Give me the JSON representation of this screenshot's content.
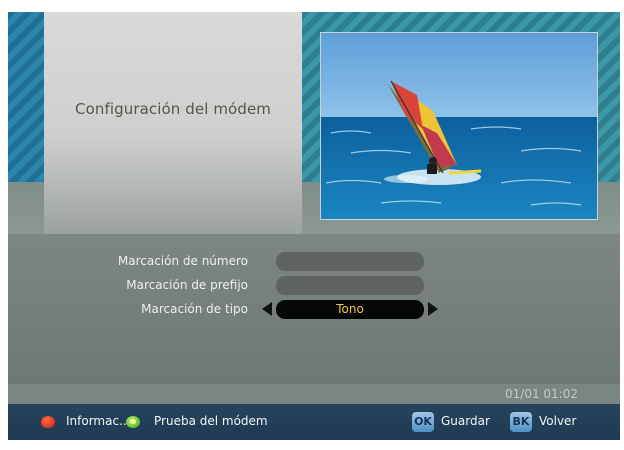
{
  "screen": {
    "title": "Configuración del módem"
  },
  "settings": {
    "rows": [
      {
        "label": "Marcación de número",
        "value": ""
      },
      {
        "label": "Marcación de prefijo",
        "value": ""
      },
      {
        "label": "Marcación de tipo",
        "value": "Tono"
      }
    ]
  },
  "status": {
    "datetime": "01/01 01:02"
  },
  "footer": {
    "info_label": "Informac...",
    "modem_test_label": "Prueba del módem",
    "ok_key": "OK",
    "save_label": "Guardar",
    "bk_key": "BK",
    "back_label": "Volver"
  },
  "colors": {
    "accent_value": "#f2c84a",
    "footer_bg": "#27445e",
    "red_button": "#d51b0b",
    "green_button": "#3ea51b"
  },
  "icons": {
    "left_arrow": "arrow-left-icon",
    "right_arrow": "arrow-right-icon"
  }
}
